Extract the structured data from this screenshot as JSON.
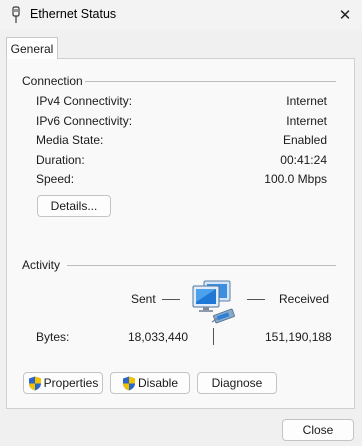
{
  "window": {
    "title": "Ethernet Status",
    "close_glyph": "✕"
  },
  "tabs": [
    {
      "label": "General"
    }
  ],
  "connection": {
    "heading": "Connection",
    "rows": [
      {
        "label": "IPv4 Connectivity:",
        "value": "Internet"
      },
      {
        "label": "IPv6 Connectivity:",
        "value": "Internet"
      },
      {
        "label": "Media State:",
        "value": "Enabled"
      },
      {
        "label": "Duration:",
        "value": "00:41:24"
      },
      {
        "label": "Speed:",
        "value": "100.0 Mbps"
      }
    ],
    "details_button": "Details..."
  },
  "activity": {
    "heading": "Activity",
    "sent_label": "Sent",
    "received_label": "Received",
    "bytes_label": "Bytes:",
    "bytes_sent": "18,033,440",
    "bytes_received": "151,190,188",
    "icon": "network-computer-icon"
  },
  "buttons": {
    "properties": "Properties",
    "disable": "Disable",
    "diagnose": "Diagnose",
    "close": "Close"
  },
  "colors": {
    "panel": "#f9f9f9",
    "window": "#f0f0f0",
    "shield_blue": "#2a66c9",
    "shield_yellow": "#f2c200"
  }
}
